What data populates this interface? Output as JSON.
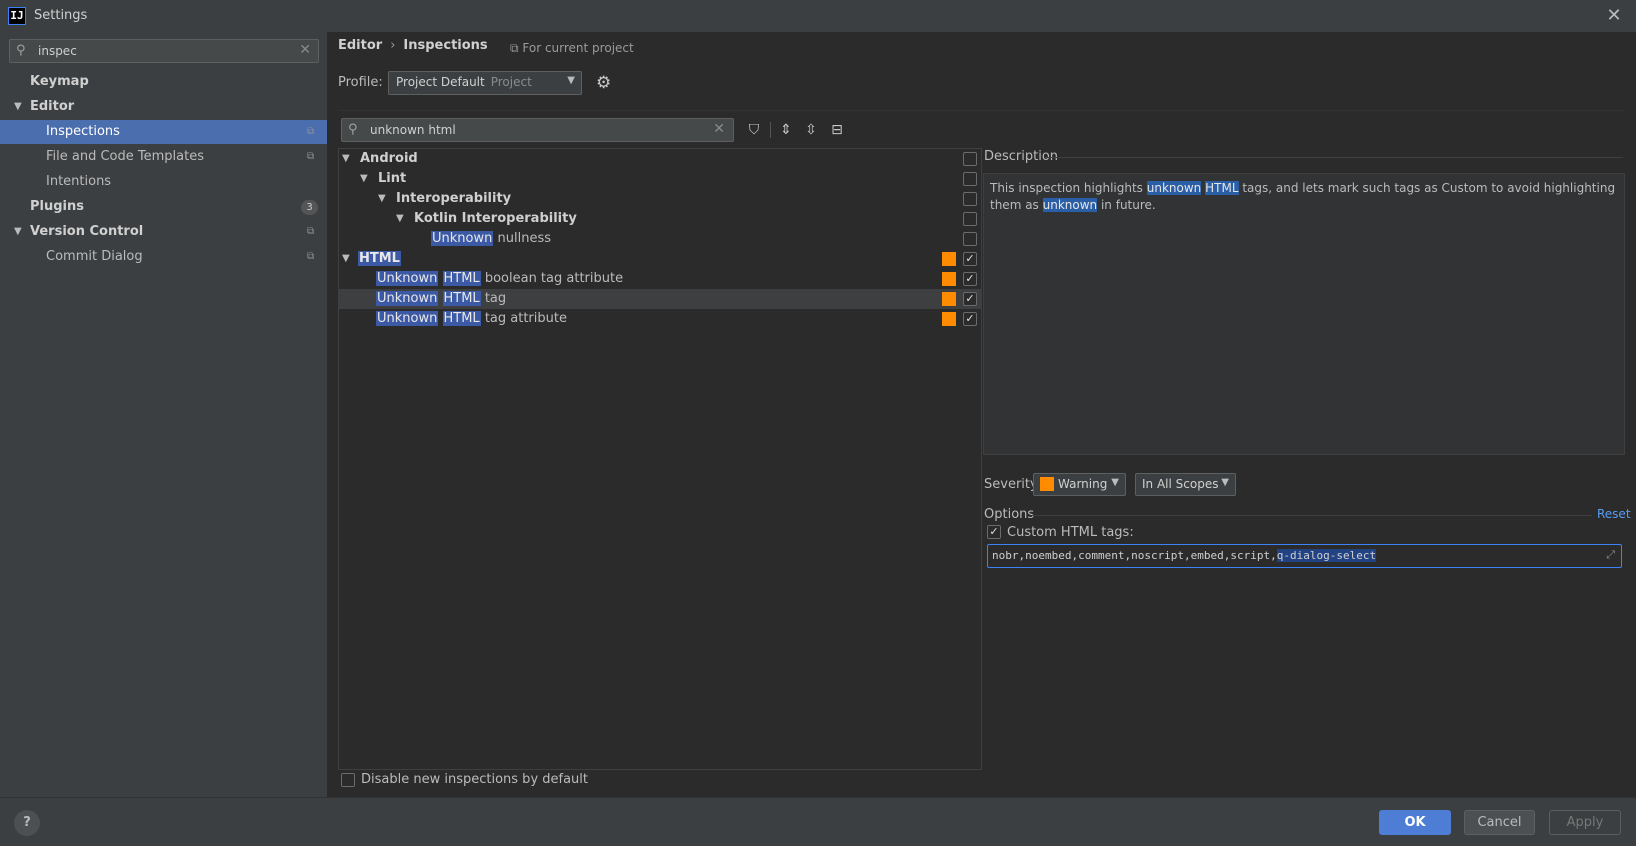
{
  "window": {
    "title": "Settings",
    "logo_text": "IJ",
    "close_glyph": "✕"
  },
  "sidebar": {
    "search": {
      "value": "inspec",
      "icon": "search-icon"
    },
    "items": [
      {
        "label": "Keymap"
      },
      {
        "label": "Editor",
        "arrow": "▼"
      },
      {
        "label": "Inspections"
      },
      {
        "label": "File and Code Templates"
      },
      {
        "label": "Intentions"
      },
      {
        "label": "Plugins",
        "badge": "3"
      },
      {
        "label": "Version Control",
        "arrow": "▼"
      },
      {
        "label": "Commit Dialog"
      }
    ]
  },
  "header": {
    "breadcrumb_parent": "Editor",
    "breadcrumb_sep": "›",
    "breadcrumb_current": "Inspections",
    "for_project": "For current project",
    "profile_label": "Profile:",
    "profile_value": "Project Default",
    "profile_scope": "Project"
  },
  "inspections": {
    "search_value": "unknown html",
    "tree": [
      {
        "label": "Android",
        "arrow": "▼"
      },
      {
        "label": "Lint",
        "arrow": "▼"
      },
      {
        "label": "Interoperability",
        "arrow": "▼"
      },
      {
        "label": "Kotlin Interoperability",
        "arrow": "▼"
      },
      {
        "hl1": "Unknown",
        "rest": "nullness"
      },
      {
        "hl1": "HTML",
        "arrow": "▼"
      },
      {
        "hl1": "Unknown",
        "hl2": "HTML",
        "rest": "boolean tag attribute"
      },
      {
        "hl1": "Unknown",
        "hl2": "HTML",
        "rest": "tag"
      },
      {
        "hl1": "Unknown",
        "hl2": "HTML",
        "rest": "tag attribute"
      }
    ],
    "disable_new_label": "Disable new inspections by default"
  },
  "description": {
    "label": "Description",
    "t1": "This inspection highlights ",
    "h1": "unknown",
    "h2": "HTML",
    "t2": " tags, and lets mark such tags as Custom to avoid highlighting them as ",
    "h3": "unknown",
    "t3": " in future."
  },
  "severity": {
    "label": "Severity:",
    "value": "Warning",
    "color": "#ff8c00",
    "scope": "In All Scopes"
  },
  "options": {
    "label": "Options",
    "reset": "Reset",
    "custom_tags_label": "Custom HTML tags:",
    "custom_tags_value": "nobr,noembed,comment,noscript,embed,script,",
    "custom_tags_selected": "q-dialog-select"
  },
  "footer": {
    "help": "?",
    "ok": "OK",
    "cancel": "Cancel",
    "apply": "Apply"
  }
}
